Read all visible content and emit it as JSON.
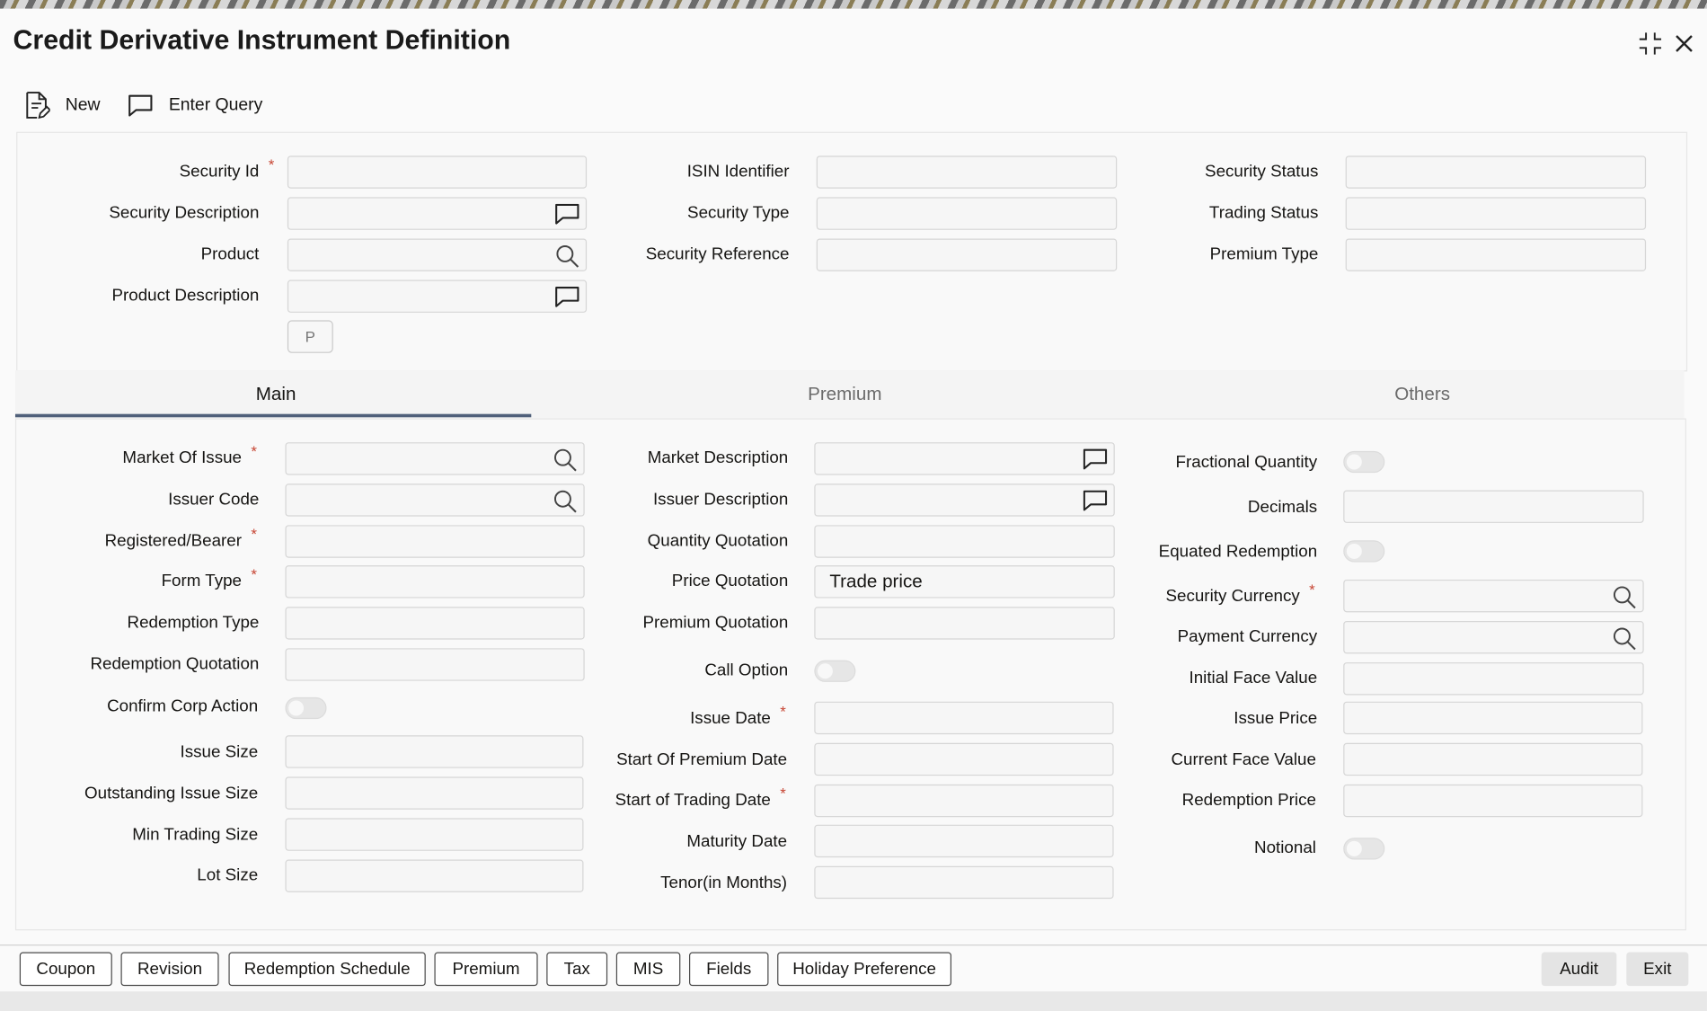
{
  "window": {
    "title": "Credit Derivative Instrument Definition"
  },
  "toolbar": {
    "new_label": "New",
    "enter_query_label": "Enter Query"
  },
  "header": {
    "security_id": {
      "label": "Security Id",
      "value": ""
    },
    "security_description": {
      "label": "Security Description",
      "value": ""
    },
    "product": {
      "label": "Product",
      "value": ""
    },
    "product_description": {
      "label": "Product Description",
      "value": ""
    },
    "isin_identifier": {
      "label": "ISIN Identifier",
      "value": ""
    },
    "security_type": {
      "label": "Security Type",
      "value": ""
    },
    "security_reference": {
      "label": "Security Reference",
      "value": ""
    },
    "security_status": {
      "label": "Security Status",
      "value": ""
    },
    "trading_status": {
      "label": "Trading Status",
      "value": ""
    },
    "premium_type": {
      "label": "Premium Type",
      "value": ""
    },
    "p_button": "P"
  },
  "tabs": [
    {
      "label": "Main",
      "active": true
    },
    {
      "label": "Premium",
      "active": false
    },
    {
      "label": "Others",
      "active": false
    }
  ],
  "main": {
    "col1": {
      "market_of_issue": {
        "label": "Market Of Issue",
        "value": ""
      },
      "issuer_code": {
        "label": "Issuer Code",
        "value": ""
      },
      "registered_bearer": {
        "label": "Registered/Bearer",
        "value": ""
      },
      "form_type": {
        "label": "Form Type",
        "value": ""
      },
      "redemption_type": {
        "label": "Redemption Type",
        "value": ""
      },
      "redemption_quotation": {
        "label": "Redemption Quotation",
        "value": ""
      },
      "confirm_corp_action": {
        "label": "Confirm Corp Action",
        "checked": false
      },
      "issue_size": {
        "label": "Issue Size",
        "value": ""
      },
      "outstanding_issue_size": {
        "label": "Outstanding Issue Size",
        "value": ""
      },
      "min_trading_size": {
        "label": "Min Trading Size",
        "value": ""
      },
      "lot_size": {
        "label": "Lot Size",
        "value": ""
      }
    },
    "col2": {
      "market_description": {
        "label": "Market Description",
        "value": ""
      },
      "issuer_description": {
        "label": "Issuer Description",
        "value": ""
      },
      "quantity_quotation": {
        "label": "Quantity Quotation",
        "value": ""
      },
      "price_quotation": {
        "label": "Price Quotation",
        "value": "Trade price"
      },
      "premium_quotation": {
        "label": "Premium Quotation",
        "value": ""
      },
      "call_option": {
        "label": "Call Option",
        "checked": false
      },
      "issue_date": {
        "label": "Issue Date",
        "value": ""
      },
      "start_of_premium_date": {
        "label": "Start Of Premium Date",
        "value": ""
      },
      "start_of_trading_date": {
        "label": "Start of Trading Date",
        "value": ""
      },
      "maturity_date": {
        "label": "Maturity Date",
        "value": ""
      },
      "tenor": {
        "label": "Tenor(in Months)",
        "value": ""
      }
    },
    "col3": {
      "fractional_quantity": {
        "label": "Fractional Quantity",
        "checked": false
      },
      "decimals": {
        "label": "Decimals",
        "value": ""
      },
      "equated_redemption": {
        "label": "Equated Redemption",
        "checked": false
      },
      "security_currency": {
        "label": "Security Currency",
        "value": ""
      },
      "payment_currency": {
        "label": "Payment Currency",
        "value": ""
      },
      "initial_face_value": {
        "label": "Initial Face Value",
        "value": ""
      },
      "issue_price": {
        "label": "Issue Price",
        "value": ""
      },
      "current_face_value": {
        "label": "Current Face Value",
        "value": ""
      },
      "redemption_price": {
        "label": "Redemption Price",
        "value": ""
      },
      "notional": {
        "label": "Notional",
        "checked": false
      }
    }
  },
  "footer": {
    "buttons": [
      "Coupon",
      "Revision",
      "Redemption Schedule",
      "Premium",
      "Tax",
      "MIS",
      "Fields",
      "Holiday Preference"
    ],
    "audit": "Audit",
    "exit": "Exit"
  },
  "colors": {
    "required": "#c74634",
    "tab_underline": "#50607a",
    "input_bg": "#f6f6f6"
  }
}
